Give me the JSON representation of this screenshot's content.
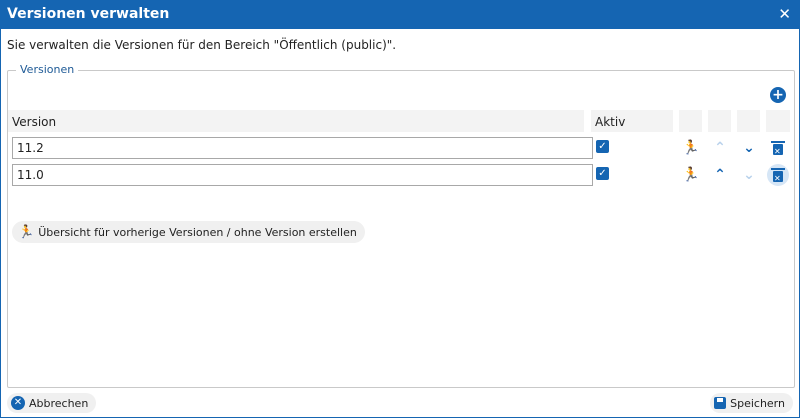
{
  "dialog": {
    "title": "Versionen verwalten",
    "close_icon": "✕",
    "description": "Sie verwalten die Versionen für den Bereich \"Öffentlich (public)\"."
  },
  "fieldset": {
    "legend": "Versionen",
    "add_icon": "+",
    "headers": {
      "version": "Version",
      "active": "Aktiv"
    },
    "rows": [
      {
        "version": "11.2",
        "active": true,
        "up_enabled": false,
        "down_enabled": true
      },
      {
        "version": "11.0",
        "active": true,
        "up_enabled": true,
        "down_enabled": false
      }
    ],
    "overview_button": "Übersicht für vorherige Versionen / ohne Version erstellen"
  },
  "footer": {
    "cancel_label": "Abbrechen",
    "save_label": "Speichern"
  },
  "icons": {
    "check": "✓",
    "runner": "🏃",
    "chevron_up": "⌃",
    "chevron_down": "⌄",
    "cancel": "✕"
  },
  "colors": {
    "accent": "#1565b2",
    "header_bg": "#f3f3f3"
  }
}
